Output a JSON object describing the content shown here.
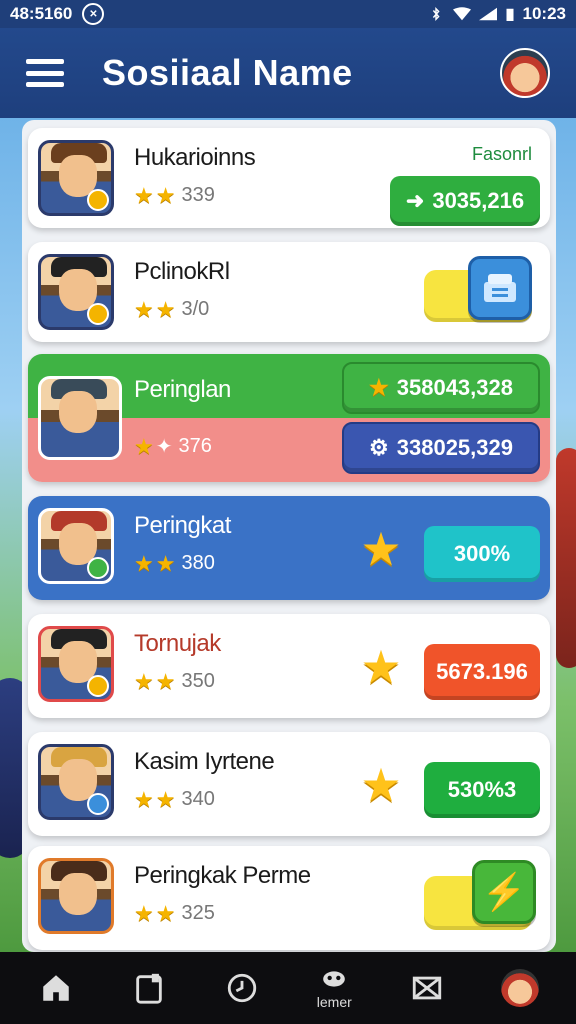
{
  "status_bar": {
    "left_text": "48:5160",
    "time": "10:23"
  },
  "app_bar": {
    "title": "Sosiiaal Name"
  },
  "leaderboard": [
    {
      "name": "Hukarioinns",
      "stars": 2,
      "rating": "339",
      "score": "3035,216",
      "score_color": "#2fae3f",
      "tag": "Fasonrl"
    },
    {
      "name": "PclinokRl",
      "stars": 2,
      "rating": "3/0",
      "score": "",
      "score_color": "#3b8fdb"
    },
    {
      "name": "Peringlan",
      "stars": 1,
      "rating": "376",
      "score": "358043,328",
      "score_color": "#3fb344",
      "score2": "338025,329",
      "score2_color": "#3a56b0"
    },
    {
      "name": "Peringkat",
      "stars": 2,
      "rating": "380",
      "score": "300%",
      "score_color": "#1fc3c9"
    },
    {
      "name": "Tornujak",
      "stars": 2,
      "rating": "350",
      "score": "5673.196",
      "score_color": "#f0542a"
    },
    {
      "name": "Kasim Iyrtene",
      "stars": 2,
      "rating": "340",
      "score": "530%3",
      "score_color": "#1fae3f"
    },
    {
      "name": "Peringkak Perme",
      "stars": 2,
      "rating": "325",
      "score": "",
      "score_color": "#48b73a"
    }
  ],
  "bottom_nav": {
    "items": [
      {
        "icon": "home-icon",
        "label": ""
      },
      {
        "icon": "clipboard-icon",
        "label": ""
      },
      {
        "icon": "clock-icon",
        "label": ""
      },
      {
        "icon": "gamepad-icon",
        "label": "lemer"
      },
      {
        "icon": "mail-icon",
        "label": ""
      },
      {
        "icon": "profile-avatar",
        "label": ""
      }
    ]
  }
}
